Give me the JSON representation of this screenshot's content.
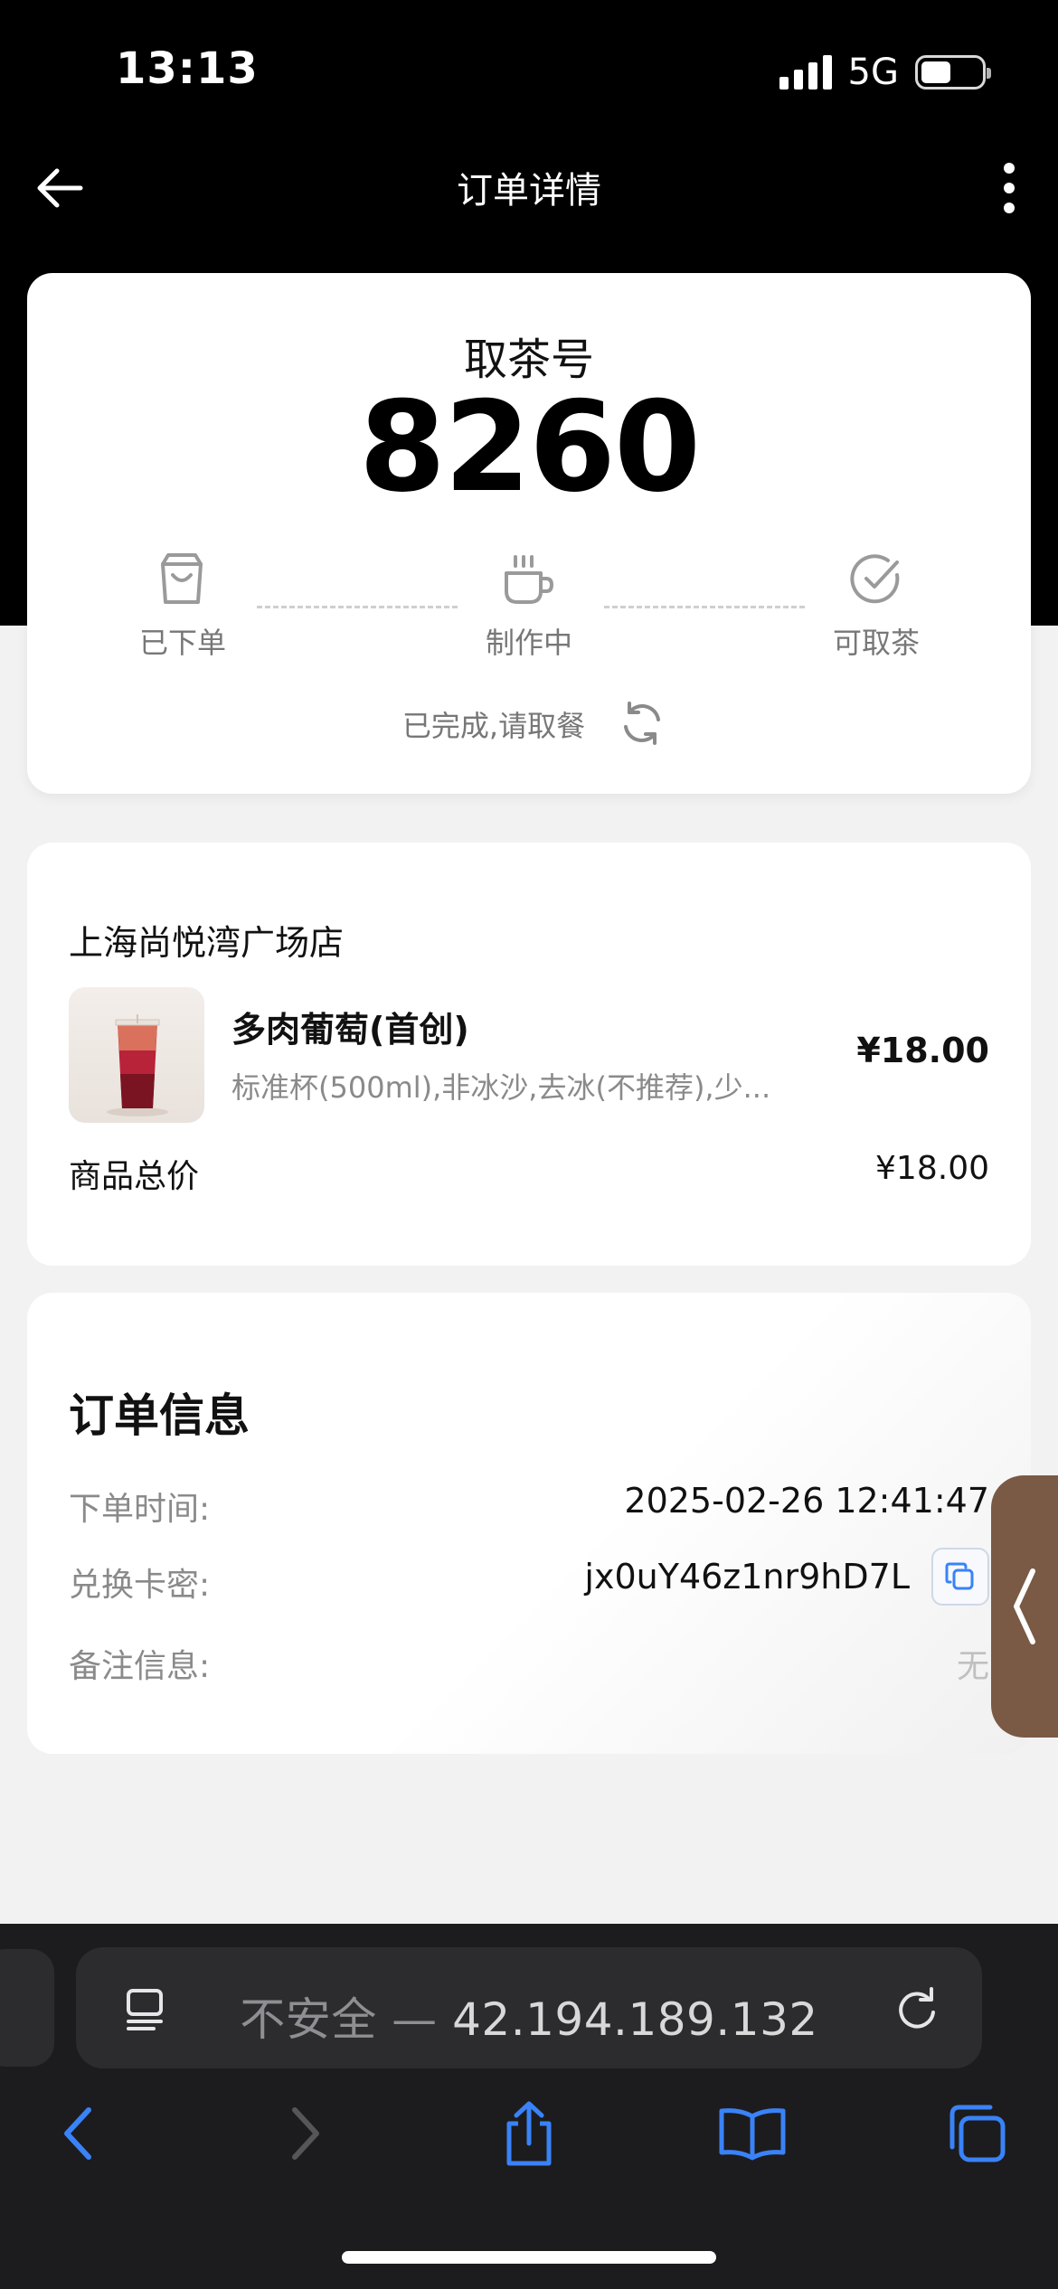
{
  "status_bar": {
    "time": "13:13",
    "network": "5G"
  },
  "nav": {
    "title": "订单详情"
  },
  "pickup": {
    "label": "取茶号",
    "number": "8260",
    "steps": [
      "已下单",
      "制作中",
      "可取茶"
    ],
    "status": "已完成,请取餐"
  },
  "order": {
    "store": "上海尚悦湾广场店",
    "item": {
      "name": "多肉葡萄(首创)",
      "spec": "标准杯(500ml),非冰沙,去冰(不推荐),少...",
      "price": "¥18.00"
    },
    "total_label": "商品总价",
    "total_value": "¥18.00"
  },
  "info": {
    "title": "订单信息",
    "order_time_label": "下单时间:",
    "order_time": "2025-02-26 12:41:47",
    "card_code_label": "兑换卡密:",
    "card_code": "jx0uY46z1nr9hD7L",
    "note_label": "备注信息:",
    "note": "无"
  },
  "browser": {
    "security": "不安全 —",
    "address": "42.194.189.132"
  },
  "colors": {
    "accent": "#3a82f7",
    "handle": "#7a5a45"
  }
}
